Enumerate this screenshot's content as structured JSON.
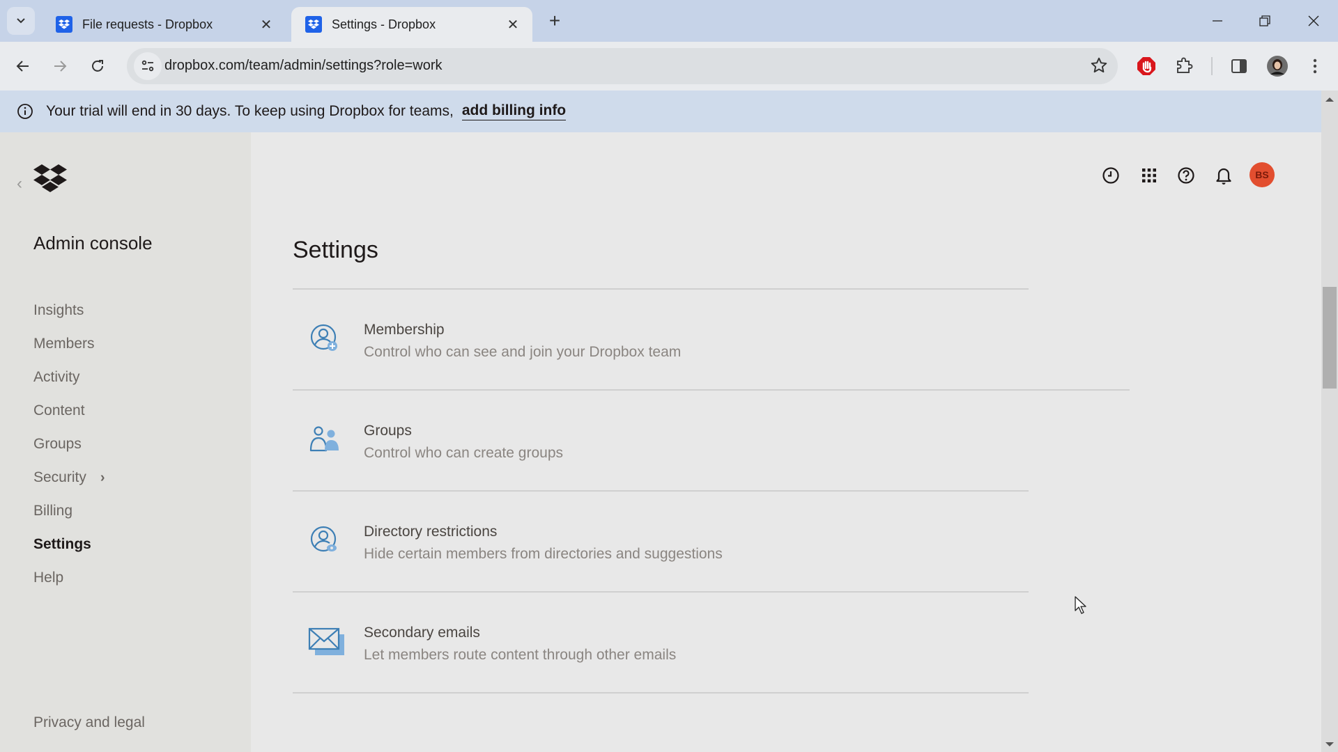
{
  "browser": {
    "tabs": [
      {
        "title": "File requests - Dropbox",
        "active": false
      },
      {
        "title": "Settings - Dropbox",
        "active": true
      }
    ],
    "url": "dropbox.com/team/admin/settings?role=work",
    "icons": {
      "tab_search": "chevron-down-icon",
      "new_tab": "plus-icon",
      "back": "arrow-left-icon",
      "forward": "arrow-right-icon",
      "reload": "reload-icon",
      "site_info": "tune-icon",
      "bookmark": "star-icon",
      "adblock": "adblock-hand-icon",
      "extensions": "puzzle-icon",
      "side_panel": "side-panel-icon",
      "profile": "profile-avatar",
      "menu": "kebab-menu-icon"
    },
    "new_tab_symbol": "+",
    "close_symbol": "✕"
  },
  "banner": {
    "text": "Your trial will end in 30 days. To keep using Dropbox for teams,",
    "link": "add billing info"
  },
  "sidebar": {
    "title": "Admin console",
    "items": [
      {
        "label": "Insights",
        "active": false
      },
      {
        "label": "Members",
        "active": false
      },
      {
        "label": "Activity",
        "active": false
      },
      {
        "label": "Content",
        "active": false
      },
      {
        "label": "Groups",
        "active": false
      },
      {
        "label": "Security",
        "active": false,
        "has_submenu": true
      },
      {
        "label": "Billing",
        "active": false
      },
      {
        "label": "Settings",
        "active": true
      },
      {
        "label": "Help",
        "active": false
      }
    ],
    "footer_link": "Privacy and legal",
    "back_symbol": "‹",
    "submenu_symbol": "›"
  },
  "header": {
    "icons": [
      "clock-icon",
      "app-grid-icon",
      "help-icon",
      "bell-icon"
    ],
    "avatar_initials": "BS",
    "avatar_color": "#e24e2f"
  },
  "main": {
    "title": "Settings",
    "settings": [
      {
        "title": "Membership",
        "description": "Control who can see and join your Dropbox team",
        "icon": "user-add-icon"
      },
      {
        "title": "Groups",
        "description": "Control who can create groups",
        "icon": "groups-icon"
      },
      {
        "title": "Directory restrictions",
        "description": "Hide certain members from directories and suggestions",
        "icon": "user-visibility-icon"
      },
      {
        "title": "Secondary emails",
        "description": "Let members route content through other emails",
        "icon": "envelope-icon"
      }
    ]
  },
  "colors": {
    "accent_blue": "#3d7fb5",
    "icon_fill_blue": "#7fb0dd",
    "banner_bg": "#cfdbeb",
    "sidebar_bg": "#e1e1de",
    "main_bg": "#e8e8e8"
  }
}
